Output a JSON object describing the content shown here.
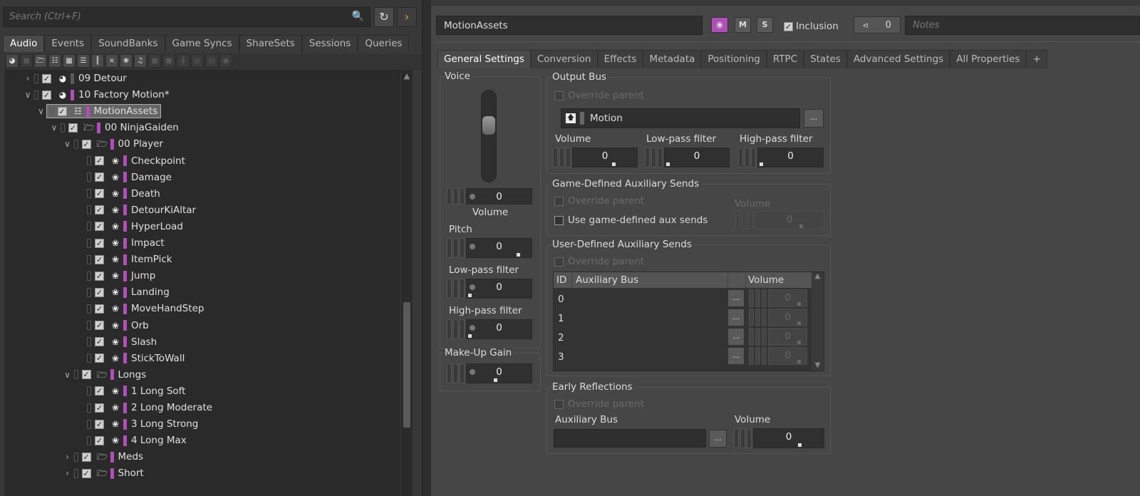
{
  "left": {
    "search_placeholder": "Search (Ctrl+F)",
    "icons": {
      "search": "magnifier-icon",
      "refresh": "refresh-icon",
      "expand": "chevron-right-icon"
    },
    "tabs": [
      "Audio",
      "Events",
      "SoundBanks",
      "Game Syncs",
      "ShareSets",
      "Sessions",
      "Queries"
    ],
    "active_tab": "Audio",
    "tree": [
      {
        "level": 0,
        "name": "09 Detour",
        "type": "work-unit",
        "state": "collapsed",
        "color": "#5a5a5a"
      },
      {
        "level": 0,
        "name": "10 Factory Motion*",
        "type": "work-unit",
        "state": "expanded",
        "color": "#b04fb8"
      },
      {
        "level": 1,
        "name": "MotionAssets",
        "type": "actor-mixer",
        "state": "expanded",
        "color": "#b04fb8",
        "selected": true
      },
      {
        "level": 2,
        "name": "00 NinjaGaiden",
        "type": "folder",
        "state": "expanded",
        "color": "#b04fb8"
      },
      {
        "level": 3,
        "name": "00 Player",
        "type": "folder",
        "state": "expanded",
        "color": "#b04fb8"
      },
      {
        "level": 4,
        "name": "Checkpoint",
        "type": "motion-fx",
        "color": "#b04fb8"
      },
      {
        "level": 4,
        "name": "Damage",
        "type": "motion-fx",
        "color": "#b04fb8"
      },
      {
        "level": 4,
        "name": "Death",
        "type": "motion-fx",
        "color": "#b04fb8"
      },
      {
        "level": 4,
        "name": "DetourKiAltar",
        "type": "motion-fx",
        "color": "#b04fb8"
      },
      {
        "level": 4,
        "name": "HyperLoad",
        "type": "motion-fx",
        "color": "#b04fb8"
      },
      {
        "level": 4,
        "name": "Impact",
        "type": "motion-fx",
        "color": "#b04fb8"
      },
      {
        "level": 4,
        "name": "ItemPick",
        "type": "motion-fx",
        "color": "#b04fb8"
      },
      {
        "level": 4,
        "name": "Jump",
        "type": "motion-fx",
        "color": "#b04fb8"
      },
      {
        "level": 4,
        "name": "Landing",
        "type": "motion-fx",
        "color": "#b04fb8"
      },
      {
        "level": 4,
        "name": "MoveHandStep",
        "type": "motion-fx",
        "color": "#b04fb8"
      },
      {
        "level": 4,
        "name": "Orb",
        "type": "motion-fx",
        "color": "#b04fb8"
      },
      {
        "level": 4,
        "name": "Slash",
        "type": "motion-fx",
        "color": "#b04fb8"
      },
      {
        "level": 4,
        "name": "StickToWall",
        "type": "motion-fx",
        "color": "#b04fb8"
      },
      {
        "level": 3,
        "name": "Longs",
        "type": "folder",
        "state": "expanded",
        "color": "#b04fb8"
      },
      {
        "level": 4,
        "name": "1 Long Soft",
        "type": "motion-fx",
        "color": "#b04fb8"
      },
      {
        "level": 4,
        "name": "2 Long Moderate",
        "type": "motion-fx",
        "color": "#b04fb8"
      },
      {
        "level": 4,
        "name": "3 Long Strong",
        "type": "motion-fx",
        "color": "#b04fb8"
      },
      {
        "level": 4,
        "name": "4 Long Max",
        "type": "motion-fx",
        "color": "#b04fb8"
      },
      {
        "level": 3,
        "name": "Meds",
        "type": "folder",
        "state": "collapsed",
        "color": "#b04fb8"
      },
      {
        "level": 3,
        "name": "Short",
        "type": "folder",
        "state": "collapsed",
        "color": "#b04fb8"
      }
    ]
  },
  "right": {
    "object_name": "MotionAssets",
    "color_button": "#b04fb8",
    "mute_label": "M",
    "solo_label": "S",
    "inclusion_label": "Inclusion",
    "inclusion_checked": true,
    "references_count": "0",
    "notes_placeholder": "Notes",
    "tabs": [
      "General Settings",
      "Conversion",
      "Effects",
      "Metadata",
      "Positioning",
      "RTPC",
      "States",
      "Advanced Settings",
      "All Properties",
      "+"
    ],
    "active_tab": "General Settings",
    "voice": {
      "title": "Voice",
      "volume_label": "Volume",
      "volume": "0",
      "pitch_label": "Pitch",
      "pitch": "0",
      "lpf_label": "Low-pass filter",
      "lpf": "0",
      "hpf_label": "High-pass filter",
      "hpf": "0"
    },
    "makeup": {
      "title": "Make-Up Gain",
      "value": "0"
    },
    "output_bus": {
      "title": "Output Bus",
      "override": "Override parent",
      "bus": "Motion",
      "browse": "...",
      "volume_label": "Volume",
      "volume": "0",
      "lpf_label": "Low-pass filter",
      "lpf": "0",
      "hpf_label": "High-pass filter",
      "hpf": "0"
    },
    "game_aux": {
      "title": "Game-Defined Auxiliary Sends",
      "override": "Override parent",
      "use_label": "Use game-defined aux sends",
      "volume_label": "Volume",
      "volume": "0"
    },
    "user_aux": {
      "title": "User-Defined Auxiliary Sends",
      "override": "Override parent",
      "columns": [
        "ID",
        "Auxiliary Bus",
        "",
        "Volume"
      ],
      "rows": [
        {
          "id": "0",
          "bus": "",
          "volume": "0"
        },
        {
          "id": "1",
          "bus": "",
          "volume": "0"
        },
        {
          "id": "2",
          "bus": "",
          "volume": "0"
        },
        {
          "id": "3",
          "bus": "",
          "volume": "0"
        }
      ],
      "browse": "..."
    },
    "early_reflections": {
      "title": "Early Reflections",
      "override": "Override parent",
      "bus_label": "Auxiliary Bus",
      "bus": "",
      "browse": "...",
      "volume_label": "Volume",
      "volume": "0"
    }
  }
}
